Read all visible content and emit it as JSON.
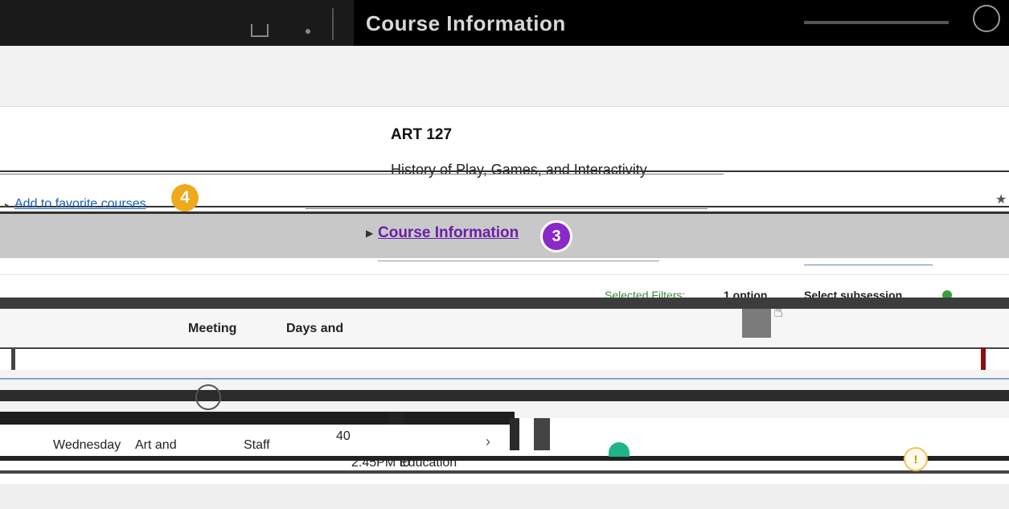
{
  "header": {
    "title": "Course Information"
  },
  "course": {
    "code": "ART 127",
    "title": "History of Play, Games, and Interactivity"
  },
  "favorites": {
    "link_label": "Add to favorite courses",
    "step_badge": "4"
  },
  "course_information": {
    "label": "Course Information",
    "step_badge": "3"
  },
  "filters": {
    "label": "Selected Filters:",
    "value": "1 option",
    "subsession_label": "Select subsession"
  },
  "table": {
    "headers": {
      "meeting": "Meeting",
      "days": "Days and"
    },
    "row": {
      "days": "Wednesday",
      "building": "Art and",
      "instructor": "Staff",
      "seats": "40",
      "time": "2:45PM to",
      "room": "Education"
    }
  },
  "colors": {
    "accent_purple": "#8a28c8",
    "accent_orange": "#f0a81c",
    "link_blue": "#1a5fb4",
    "filter_green": "#3a8a3a"
  }
}
